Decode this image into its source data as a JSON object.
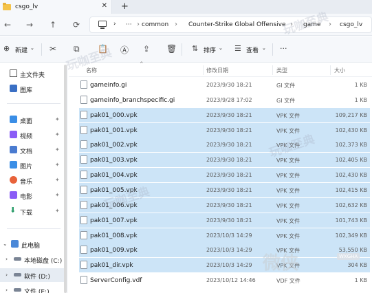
{
  "window": {
    "tab_title": "csgo_lv",
    "tab_close": "✕",
    "new_tab": "+"
  },
  "nav": {
    "back": "←",
    "forward": "→",
    "up": "↑",
    "refresh": "⟳"
  },
  "breadcrumbs": {
    "more": "···",
    "items": [
      "common",
      "Counter-Strike Global Offensive",
      "game",
      "csgo_lv"
    ],
    "separator": "›"
  },
  "toolbar": {
    "new_label": "新建",
    "sort_label": "排序",
    "view_label": "查看",
    "more": "···",
    "icons": [
      "new-icon",
      "cut-icon",
      "copy-icon",
      "paste-icon",
      "rename-icon",
      "share-icon",
      "delete-icon",
      "sort-icon",
      "view-icon",
      "more-icon"
    ]
  },
  "sidebar": {
    "quick": [
      {
        "label": "主文件夹",
        "icon": "home-icon"
      },
      {
        "label": "图库",
        "icon": "gallery-icon"
      }
    ],
    "pinned": [
      {
        "label": "桌面",
        "icon": "desktop-icon",
        "color": "#3a8ee6"
      },
      {
        "label": "视频",
        "icon": "video-icon",
        "color": "#8a5cf6"
      },
      {
        "label": "文档",
        "icon": "document-icon",
        "color": "#4a7bd0"
      },
      {
        "label": "图片",
        "icon": "picture-icon",
        "color": "#3a8ee6"
      },
      {
        "label": "音乐",
        "icon": "music-icon",
        "color": "#e8623a"
      },
      {
        "label": "电影",
        "icon": "movie-icon",
        "color": "#8a5cf6"
      },
      {
        "label": "下载",
        "icon": "download-icon",
        "color": "#2a9d6a"
      }
    ],
    "pin_glyph": "📌",
    "this_pc": "此电脑",
    "drives": [
      "本地磁盘 (C:)",
      "软件 (D:)",
      "文件 (E:)"
    ]
  },
  "columns": {
    "name": "名称",
    "modified": "修改日期",
    "type": "类型",
    "size": "大小"
  },
  "files": [
    {
      "name": "gameinfo.gi",
      "date": "2023/9/30 18:21",
      "type": "GI 文件",
      "size": "1 KB",
      "selected": false
    },
    {
      "name": "gameinfo_branchspecific.gi",
      "date": "2023/9/28 17:02",
      "type": "GI 文件",
      "size": "1 KB",
      "selected": false
    },
    {
      "name": "pak01_000.vpk",
      "date": "2023/9/30 18:21",
      "type": "VPK 文件",
      "size": "109,217 KB",
      "selected": true
    },
    {
      "name": "pak01_001.vpk",
      "date": "2023/9/30 18:21",
      "type": "VPK 文件",
      "size": "102,430 KB",
      "selected": true
    },
    {
      "name": "pak01_002.vpk",
      "date": "2023/9/30 18:21",
      "type": "VPK 文件",
      "size": "102,373 KB",
      "selected": true
    },
    {
      "name": "pak01_003.vpk",
      "date": "2023/9/30 18:21",
      "type": "VPK 文件",
      "size": "102,405 KB",
      "selected": true
    },
    {
      "name": "pak01_004.vpk",
      "date": "2023/9/30 18:21",
      "type": "VPK 文件",
      "size": "102,430 KB",
      "selected": true
    },
    {
      "name": "pak01_005.vpk",
      "date": "2023/9/30 18:21",
      "type": "VPK 文件",
      "size": "102,415 KB",
      "selected": true
    },
    {
      "name": "pak01_006.vpk",
      "date": "2023/9/30 18:21",
      "type": "VPK 文件",
      "size": "102,632 KB",
      "selected": true
    },
    {
      "name": "pak01_007.vpk",
      "date": "2023/9/30 18:21",
      "type": "VPK 文件",
      "size": "101,743 KB",
      "selected": true
    },
    {
      "name": "pak01_008.vpk",
      "date": "2023/10/3 14:29",
      "type": "VPK 文件",
      "size": "102,349 KB",
      "selected": true
    },
    {
      "name": "pak01_009.vpk",
      "date": "2023/10/3 14:29",
      "type": "VPK 文件",
      "size": "53,550 KB",
      "selected": true
    },
    {
      "name": "pak01_dir.vpk",
      "date": "2023/10/3 14:29",
      "type": "VPK 文件",
      "size": "304 KB",
      "selected": true
    },
    {
      "name": "ServerConfig.vdf",
      "date": "2023/10/12 14:46",
      "type": "VDF 文件",
      "size": "1 KB",
      "selected": false
    }
  ],
  "watermark": {
    "text": "玩咖至典",
    "text2": "微侠",
    "text3": "WXGHA"
  },
  "colors": {
    "selection": "#cce4f7",
    "chrome": "#f6f8fb"
  }
}
